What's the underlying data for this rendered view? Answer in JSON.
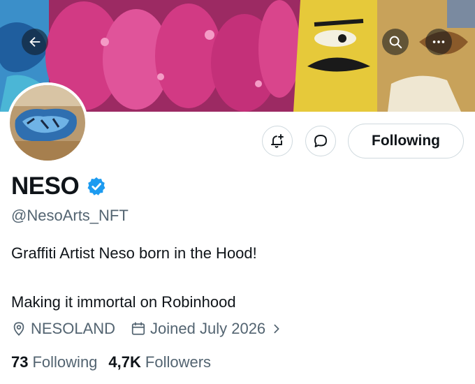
{
  "header": {
    "back_icon": "arrow-left-icon",
    "search_icon": "search-icon",
    "more_icon": "more-horizontal-icon"
  },
  "banner": {
    "description_colors": {
      "pink": "#d23a84",
      "yellow": "#e6c93a",
      "blue": "#2a63a8"
    }
  },
  "actions": {
    "notify_icon": "bell-plus-icon",
    "message_icon": "message-bubble-icon",
    "follow_label": "Following"
  },
  "profile": {
    "name": "NESO",
    "handle": "@NesoArts_NFT",
    "bio_line1": "Graffiti Artist Neso born in the Hood!",
    "bio_line2": "Making it immortal on Robinhood",
    "location": "NESOLAND",
    "joined": "Joined July 2026",
    "following_count": "73",
    "following_label": "Following",
    "followers_count": "4,7K",
    "followers_label": "Followers"
  },
  "colors": {
    "verified": "#1d9bf0",
    "text": "#0f1419",
    "secondary": "#536471"
  }
}
